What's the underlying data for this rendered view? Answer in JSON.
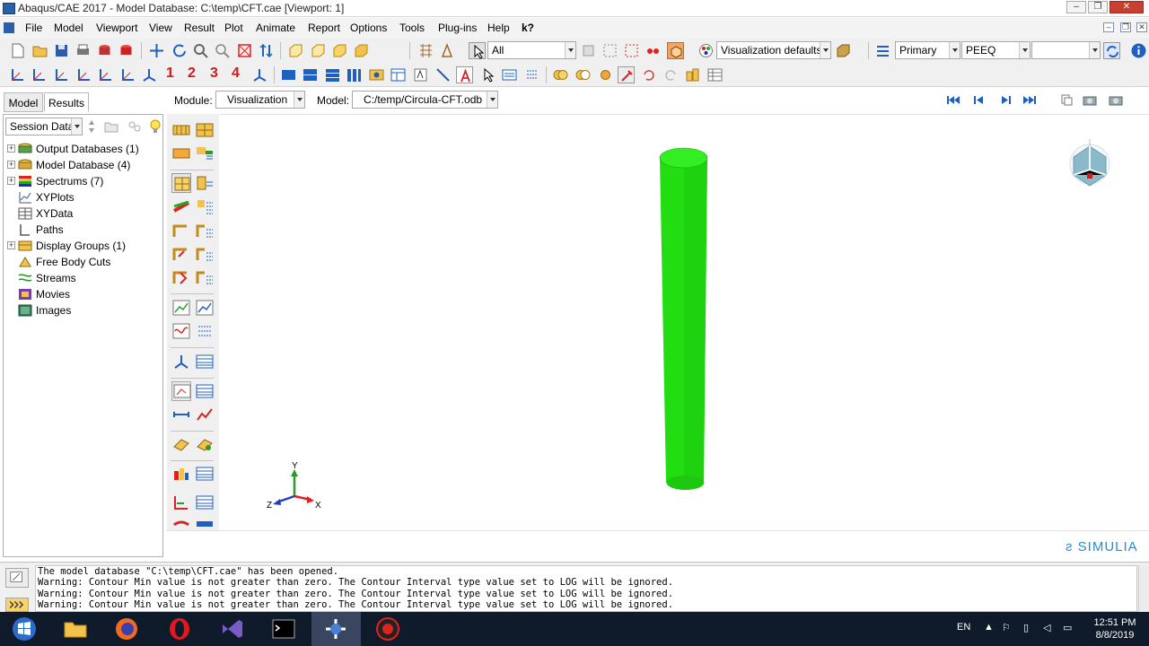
{
  "window": {
    "title": "Abaqus/CAE 2017 - Model Database: C:\\temp\\CFT.cae [Viewport: 1]",
    "controls": {
      "minimize": "–",
      "maximize": "❐",
      "close": "✕"
    }
  },
  "menu": {
    "items": [
      "File",
      "Model",
      "Viewport",
      "View",
      "Result",
      "Plot",
      "Animate",
      "Report",
      "Options",
      "Tools",
      "Plug-ins",
      "Help",
      "k?"
    ]
  },
  "toolbar": {
    "selection_filter": "All",
    "render_style": "Visualization defaults",
    "field_output_position": "Primary",
    "field_variable": "PEEQ",
    "component": "",
    "view_numbers": [
      "1",
      "2",
      "3",
      "4"
    ]
  },
  "tabs": {
    "model": "Model",
    "results": "Results"
  },
  "context": {
    "module_label": "Module:",
    "module_value": "Visualization",
    "model_label": "Model:",
    "model_value": "C:/temp/Circula-CFT.odb"
  },
  "session": {
    "dropdown": "Session Data"
  },
  "tree": [
    {
      "label": "Output Databases (1)",
      "expandable": true
    },
    {
      "label": "Model Database (4)",
      "expandable": true
    },
    {
      "label": "Spectrums (7)",
      "expandable": true
    },
    {
      "label": "XYPlots",
      "expandable": false
    },
    {
      "label": "XYData",
      "expandable": false
    },
    {
      "label": "Paths",
      "expandable": false
    },
    {
      "label": "Display Groups (1)",
      "expandable": true
    },
    {
      "label": "Free Body Cuts",
      "expandable": false
    },
    {
      "label": "Streams",
      "expandable": false
    },
    {
      "label": "Movies",
      "expandable": false
    },
    {
      "label": "Images",
      "expandable": false
    }
  ],
  "viewport": {
    "triad": {
      "y": "Y",
      "z": "Z",
      "x": "X"
    },
    "brand": "SIMULIA",
    "model_color": "#22dd11"
  },
  "messages": [
    "The model database \"C:\\temp\\CFT.cae\" has been opened.",
    "Warning: Contour Min value is not greater than zero. The Contour Interval type value set to LOG will be ignored.",
    "Warning: Contour Min value is not greater than zero. The Contour Interval type value set to LOG will be ignored.",
    "Warning: Contour Min value is not greater than zero. The Contour Interval type value set to LOG will be ignored."
  ],
  "taskbar": {
    "apps": [
      "windows-start",
      "file-explorer",
      "firefox",
      "opera",
      "visual-studio",
      "command-prompt",
      "abaqus",
      "screen-recorder"
    ],
    "language": "EN",
    "time": "12:51 PM",
    "date": "8/8/2019"
  }
}
